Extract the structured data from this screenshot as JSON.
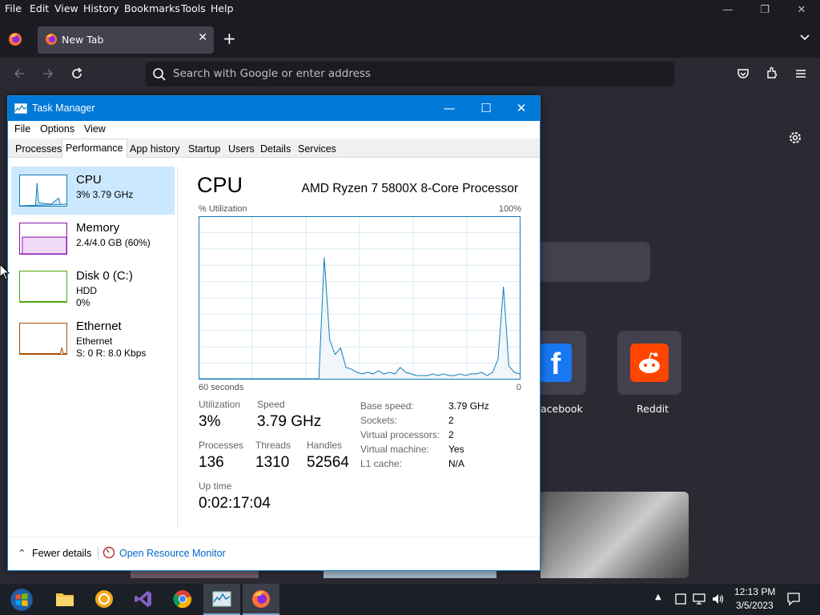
{
  "firefox": {
    "menubar": [
      {
        "key": "file",
        "label": "File"
      },
      {
        "key": "edit",
        "label": "Edit"
      },
      {
        "key": "view",
        "label": "View"
      },
      {
        "key": "history",
        "label": "History"
      },
      {
        "key": "bookmarks",
        "label": "Bookmarks"
      },
      {
        "key": "tools",
        "label": "Tools"
      },
      {
        "key": "help",
        "label": "Help"
      }
    ],
    "tab": {
      "label": "New Tab"
    },
    "urlbar": {
      "placeholder": "Search with Google or enter address"
    },
    "shortcuts": [
      {
        "label": "acebook"
      },
      {
        "label": "Reddit"
      }
    ]
  },
  "taskmanager": {
    "title": "Task Manager",
    "menu": [
      "File",
      "Options",
      "View"
    ],
    "tabs": [
      "Processes",
      "Performance",
      "App history",
      "Startup",
      "Users",
      "Details",
      "Services"
    ],
    "active_tab": "Performance",
    "resources": [
      {
        "name": "CPU",
        "sub1": "3%  3.79 GHz",
        "sub2": "",
        "color": "#117dbb"
      },
      {
        "name": "Memory",
        "sub1": "2.4/4.0 GB (60%)",
        "sub2": "",
        "color": "#8b12ae"
      },
      {
        "name": "Disk 0 (C:)",
        "sub1": "HDD",
        "sub2": "0%",
        "color": "#4da60c"
      },
      {
        "name": "Ethernet",
        "sub1": "Ethernet",
        "sub2": "S: 0  R: 8.0 Kbps",
        "color": "#a74f01"
      }
    ],
    "panel": {
      "title": "CPU",
      "model": "AMD Ryzen 7 5800X 8-Core Processor",
      "util_label": "% Utilization",
      "util_max": "100%",
      "time_span": "60 seconds",
      "time_end": "0",
      "stats": {
        "utilization_label": "Utilization",
        "utilization": "3%",
        "speed_label": "Speed",
        "speed": "3.79 GHz",
        "processes_label": "Processes",
        "processes": "136",
        "threads_label": "Threads",
        "threads": "1310",
        "handles_label": "Handles",
        "handles": "52564",
        "uptime_label": "Up time",
        "uptime": "0:02:17:04"
      },
      "details": [
        {
          "label": "Base speed:",
          "value": "3.79 GHz"
        },
        {
          "label": "Sockets:",
          "value": "2"
        },
        {
          "label": "Virtual processors:",
          "value": "2"
        },
        {
          "label": "Virtual machine:",
          "value": "Yes"
        },
        {
          "label": "L1 cache:",
          "value": "N/A"
        }
      ]
    },
    "footer": {
      "fewer": "Fewer details",
      "resmon": "Open Resource Monitor"
    }
  },
  "chart_data": {
    "type": "area",
    "title": "",
    "xlabel": "60 seconds",
    "ylabel": "% Utilization",
    "ylim": [
      0,
      100
    ],
    "xlim": [
      60,
      0
    ],
    "color": "#117dbb",
    "series": [
      {
        "values": [
          0,
          0,
          0,
          0,
          0,
          0,
          0,
          0,
          0,
          0,
          0,
          0,
          0,
          0,
          0,
          0,
          0,
          0,
          0,
          0,
          0,
          0,
          0,
          75,
          24,
          15,
          19,
          7,
          6,
          4,
          3,
          4,
          3,
          5,
          3,
          4,
          3,
          7,
          4,
          3,
          2,
          2,
          2,
          3,
          2,
          3,
          2,
          2,
          3,
          2,
          3,
          3,
          4,
          2,
          4,
          12,
          57,
          8,
          4,
          3
        ]
      }
    ]
  },
  "taskbar": {
    "time": "12:13 PM",
    "date": "3/5/2023"
  }
}
